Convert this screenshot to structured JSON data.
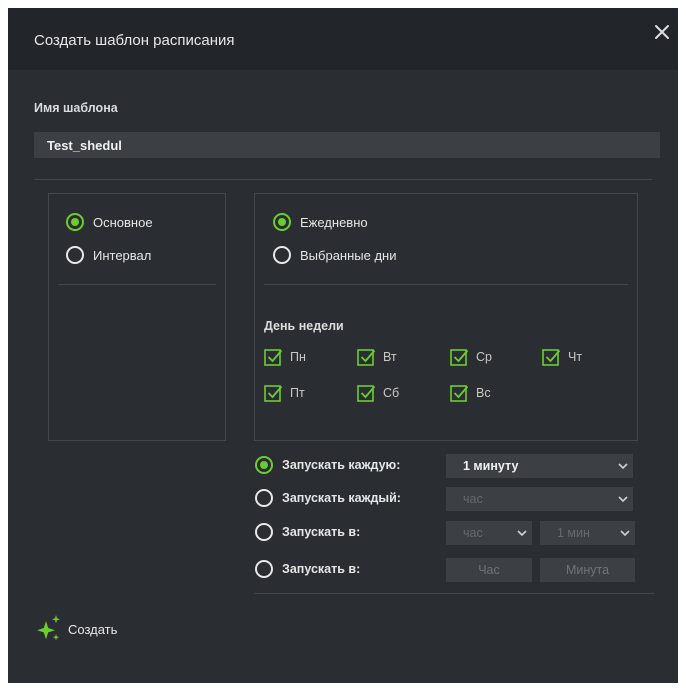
{
  "dialog": {
    "title": "Создать шаблон расписания",
    "name_label": "Имя шаблона",
    "name_value": "Test_shedul"
  },
  "type_options": [
    {
      "label": "Основное",
      "selected": true
    },
    {
      "label": "Интервал",
      "selected": false
    }
  ],
  "period_options": [
    {
      "label": "Ежедневно",
      "selected": true
    },
    {
      "label": "Выбранные дни",
      "selected": false
    }
  ],
  "weekdays": {
    "label": "День недели",
    "days": [
      {
        "label": "Пн",
        "checked": true
      },
      {
        "label": "Вт",
        "checked": true
      },
      {
        "label": "Ср",
        "checked": true
      },
      {
        "label": "Чт",
        "checked": true
      },
      {
        "label": "Пт",
        "checked": true
      },
      {
        "label": "Сб",
        "checked": true
      },
      {
        "label": "Вс",
        "checked": true
      }
    ]
  },
  "run_options": [
    {
      "label": "Запускать каждую:",
      "selected": true,
      "select_value": "1 минуту"
    },
    {
      "label": "Запускать каждый:",
      "selected": false,
      "select_value": "час"
    },
    {
      "label": "Запускать в:",
      "selected": false,
      "hour_value": "час",
      "minute_value": "1 мин"
    },
    {
      "label": "Запускать в:",
      "selected": false,
      "hour_placeholder": "Час",
      "minute_placeholder": "Минута"
    }
  ],
  "actions": {
    "create_label": "Создать"
  },
  "colors": {
    "accent": "#6ccd2e",
    "background": "#2a2d31",
    "header": "#22252a",
    "input": "#3c4045"
  }
}
